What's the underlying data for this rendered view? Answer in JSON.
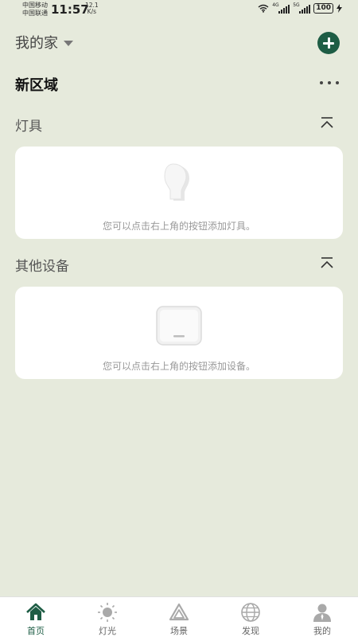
{
  "status_bar": {
    "carrier1": "中国移动",
    "carrier2": "中国联通",
    "time": "11:57",
    "net_speed_value": "12.1",
    "net_speed_unit": "K/s",
    "signal1_tag": "4G",
    "signal2_tag": "5G",
    "battery": "100"
  },
  "header": {
    "home_name": "我的家"
  },
  "area": {
    "title": "新区域"
  },
  "sections": {
    "lights": {
      "title": "灯具",
      "empty_hint": "您可以点击右上角的按钮添加灯具。"
    },
    "devices": {
      "title": "其他设备",
      "empty_hint": "您可以点击右上角的按钮添加设备。"
    }
  },
  "tabbar": {
    "home": "首页",
    "lights": "灯光",
    "scenes": "场景",
    "discover": "发现",
    "mine": "我的"
  },
  "colors": {
    "background": "#e6eadc",
    "accent": "#1e5d45"
  }
}
